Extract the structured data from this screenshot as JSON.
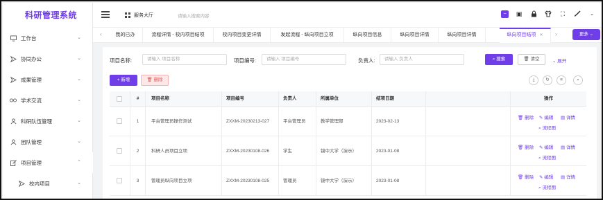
{
  "app": {
    "title": "科研管理系统"
  },
  "sidebar": {
    "items": [
      {
        "label": "工作台",
        "icon": "monitor-icon"
      },
      {
        "label": "协同办公",
        "icon": "send-icon"
      },
      {
        "label": "成果管理",
        "icon": "send-icon"
      },
      {
        "label": "学术交流",
        "icon": "glasses-icon"
      },
      {
        "label": "科研队伍管理",
        "icon": "user-icon"
      },
      {
        "label": "团队管理",
        "icon": "user-icon"
      },
      {
        "label": "项目管理",
        "icon": "edit-icon"
      }
    ],
    "subitem": {
      "label": "校内项目",
      "icon": "send-icon"
    }
  },
  "header": {
    "service_hall": "服务大厅",
    "search_placeholder": "请输入搜索内容"
  },
  "tabs": [
    {
      "label": "我的已办"
    },
    {
      "label": "流程详情 - 校内项目结项"
    },
    {
      "label": "校内项目变更详情"
    },
    {
      "label": "发起流程 - 纵向项目立项"
    },
    {
      "label": "纵向项目信息"
    },
    {
      "label": "纵向项目详情"
    },
    {
      "label": "纵向项目详情"
    },
    {
      "label": "纵向项目结项",
      "active": true
    }
  ],
  "more_label": "更多",
  "filters": {
    "name_label": "项目名称:",
    "name_placeholder": "请输入 项目名称",
    "code_label": "项目编号:",
    "code_placeholder": "请输入 项目编号",
    "owner_label": "负责人:",
    "owner_placeholder": "请输入 负责人",
    "search_label": "搜索",
    "reset_label": "清空",
    "expand_label": "展开"
  },
  "actions": {
    "add_label": "新增",
    "delete_label": "删除"
  },
  "table": {
    "headers": [
      "#",
      "项目名称",
      "项目编号",
      "负责人",
      "所属单位",
      "结项日期",
      "操作"
    ],
    "rows": [
      {
        "idx": "1",
        "name": "平台管理员操作测试",
        "code": "ZXXM-20230213-027",
        "owner": "平台管理员",
        "unit": "教学管理部",
        "date": "2023-02-13"
      },
      {
        "idx": "2",
        "name": "科研人员项目立项",
        "code": "ZXXM-20230108-026",
        "owner": "学生",
        "unit": "镜中大学（演示）",
        "date": "2023-01-08"
      },
      {
        "idx": "3",
        "name": "管理员纵向项目立项",
        "code": "ZXXM-20230108-025",
        "owner": "管理员",
        "unit": "镜中大学（演示）",
        "date": "2023-01-08"
      }
    ],
    "ops": {
      "delete": "删除",
      "edit": "编辑",
      "detail": "详情",
      "flow": "流程图"
    }
  },
  "colors": {
    "accent": "#6f3ee8",
    "danger": "#e35757"
  }
}
